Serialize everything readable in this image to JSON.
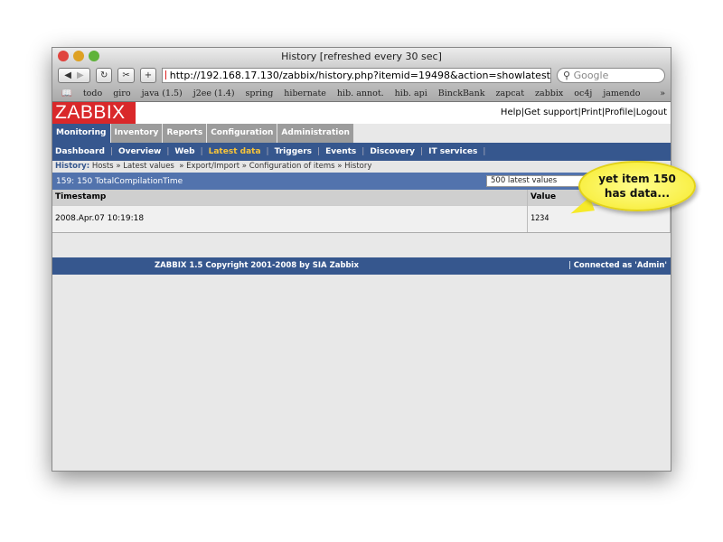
{
  "window": {
    "title": "History [refreshed every 30 sec]"
  },
  "toolbar": {
    "back": "◀",
    "forward": "▶",
    "reload": "↻",
    "snip": "✂",
    "add": "+",
    "url": "http://192.168.17.130/zabbix/history.php?itemid=19498&action=showlatest",
    "search_placeholder": "Google"
  },
  "bookmarks": [
    "todo",
    "giro",
    "java (1.5)",
    "j2ee (1.4)",
    "spring",
    "hibernate",
    "hib. annot.",
    "hib. api",
    "BinckBank",
    "zapcat",
    "zabbix",
    "oc4j",
    "jamendo"
  ],
  "bookmarks_more": "»",
  "header": {
    "logo": "ZABBIX",
    "links": [
      "Help",
      "Get support",
      "Print",
      "Profile",
      "Logout"
    ]
  },
  "main_tabs": [
    "Monitoring",
    "Inventory",
    "Reports",
    "Configuration",
    "Administration"
  ],
  "sub_tabs": [
    "Dashboard",
    "Overview",
    "Web",
    "Latest data",
    "Triggers",
    "Events",
    "Discovery",
    "IT services"
  ],
  "breadcrumb": {
    "label": "History:",
    "items": [
      "Hosts",
      "Latest values",
      "Export/Import",
      "Configuration of items",
      "History"
    ]
  },
  "item_bar": {
    "title": "159: 150 TotalCompilationTime",
    "select": "500 latest values"
  },
  "table": {
    "headers": [
      "Timestamp",
      "Value"
    ],
    "rows": [
      [
        "2008.Apr.07 10:19:18",
        "1234"
      ]
    ]
  },
  "footer": {
    "copyright": "ZABBIX 1.5 Copyright 2001-2008 by  SIA Zabbix",
    "connected": "Connected as 'Admin'"
  },
  "callout": {
    "line1": "yet item 150",
    "line2": "has data..."
  }
}
